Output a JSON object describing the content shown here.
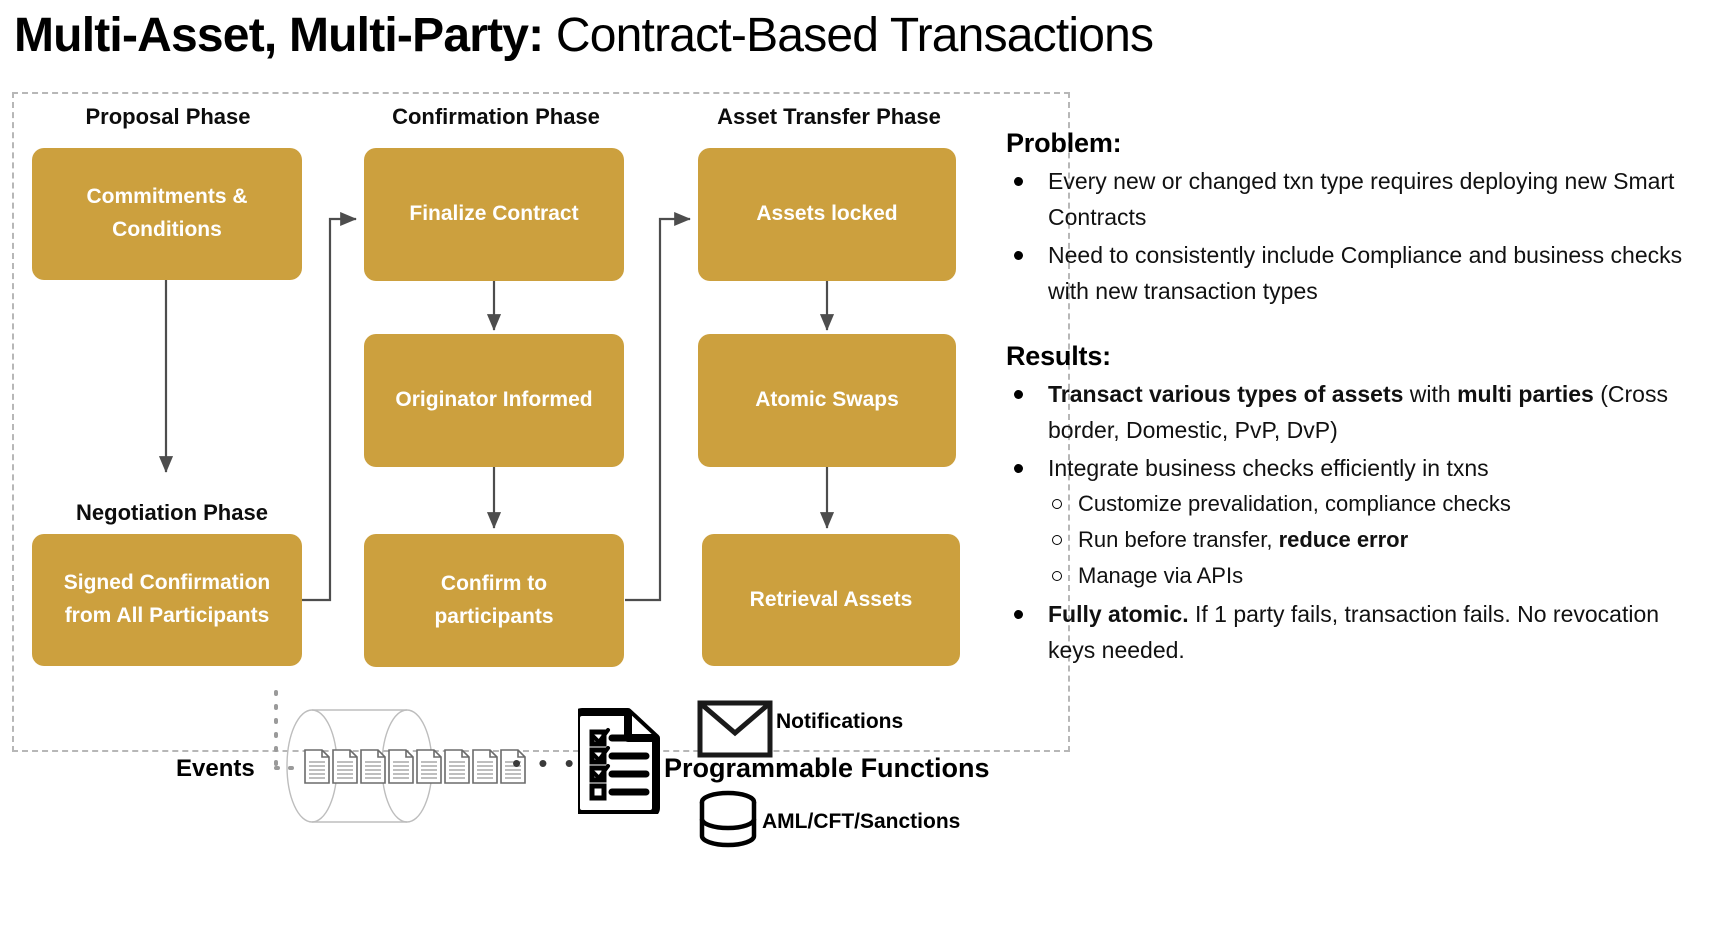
{
  "title": {
    "bold_part": "Multi-Asset, Multi-Party:",
    "light_part": " Contract-Based Transactions"
  },
  "colors": {
    "node_fill": "#cca03e",
    "node_text": "#ffffff",
    "connector": "#4d4d4d",
    "dashed_border": "#b7b7b7"
  },
  "flow": {
    "phases": [
      {
        "label": "Proposal Phase"
      },
      {
        "label": "Confirmation Phase"
      },
      {
        "label": "Asset Transfer Phase"
      },
      {
        "label": "Negotiation Phase"
      }
    ],
    "nodes": [
      {
        "id": "commitments",
        "label": "Commitments &\nConditions"
      },
      {
        "id": "signed",
        "label": "Signed Confirmation\nfrom All Participants"
      },
      {
        "id": "finalize",
        "label": "Finalize Contract"
      },
      {
        "id": "originator",
        "label": "Originator Informed"
      },
      {
        "id": "confirm",
        "label": "Confirm to\nparticipants"
      },
      {
        "id": "assets-locked",
        "label": "Assets locked"
      },
      {
        "id": "atomic-swaps",
        "label": "Atomic Swaps"
      },
      {
        "id": "retrieval",
        "label": "Retrieval Assets"
      }
    ]
  },
  "bottom_strip": {
    "events_label": "Events",
    "events_doc_count": 8,
    "ellipsis": "• • •",
    "items": [
      {
        "icon": "envelope-icon",
        "label": "Notifications"
      },
      {
        "icon": "checklist-icon",
        "label": "Programmable Functions"
      },
      {
        "icon": "database-icon",
        "label": "AML/CFT/Sanctions"
      }
    ]
  },
  "panel": {
    "problem": {
      "heading": "Problem:",
      "bullets": [
        "Every new or changed txn type requires deploying new Smart Contracts",
        "Need to consistently include Compliance and business checks with new transaction types"
      ]
    },
    "results": {
      "heading": "Results:",
      "bullet1": {
        "bold1": "Transact various types of assets",
        "mid": " with ",
        "bold2": "multi parties",
        "tail": " (Cross border, Domestic, PvP, DvP)"
      },
      "bullet2": {
        "text": "Integrate business checks efficiently in txns",
        "sub": [
          {
            "plain": "Customize prevalidation, compliance checks",
            "bold": ""
          },
          {
            "plain": "Run before transfer, ",
            "bold": "reduce error"
          },
          {
            "plain": "Manage via APIs",
            "bold": ""
          }
        ]
      },
      "bullet3": {
        "bold": "Fully atomic.",
        "tail": " If 1 party fails, transaction fails. No revocation keys needed."
      }
    }
  }
}
